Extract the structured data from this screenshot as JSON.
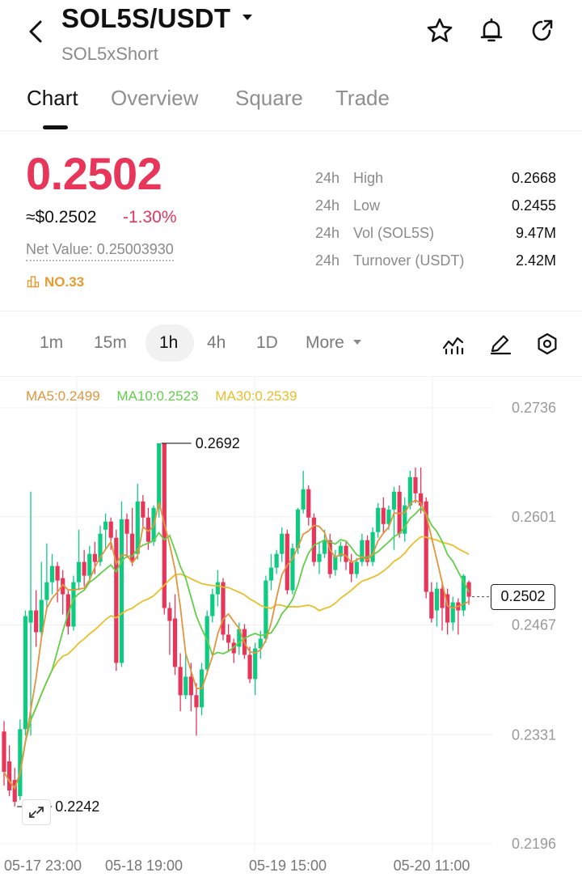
{
  "header": {
    "title": "SOL5S/USDT",
    "subtitle": "SOL5xShort"
  },
  "tabs": [
    {
      "label": "Chart",
      "active": true
    },
    {
      "label": "Overview",
      "active": false
    },
    {
      "label": "Square",
      "active": false
    },
    {
      "label": "Trade",
      "active": false
    }
  ],
  "ticker": {
    "last_price": "0.2502",
    "approx_usd": "≈$0.2502",
    "change_pct": "-1.30%",
    "net_value": "Net Value: 0.25003930",
    "rank": "NO.33",
    "down_color": "#e8355a",
    "up_color": "#0ecb81"
  },
  "stats": [
    {
      "period": "24h",
      "label": "High",
      "value": "0.2668"
    },
    {
      "period": "24h",
      "label": "Low",
      "value": "0.2455"
    },
    {
      "period": "24h",
      "label": "Vol (SOL5S)",
      "value": "9.47M"
    },
    {
      "period": "24h",
      "label": "Turnover (USDT)",
      "value": "2.42M"
    }
  ],
  "intervals": [
    {
      "label": "1m",
      "active": false
    },
    {
      "label": "15m",
      "active": false
    },
    {
      "label": "1h",
      "active": true
    },
    {
      "label": "4h",
      "active": false
    },
    {
      "label": "1D",
      "active": false
    },
    {
      "label": "More",
      "active": false
    }
  ],
  "toolbar_icons": [
    "indicator-icon",
    "draw-icon",
    "settings-icon"
  ],
  "ma": [
    {
      "label": "MA5:0.2499",
      "color": "#e2953f"
    },
    {
      "label": "MA10:0.2523",
      "color": "#62cf4a"
    },
    {
      "label": "MA30:0.2539",
      "color": "#e9bf2c"
    }
  ],
  "chart_data": {
    "type": "candlestick",
    "y_ticks": [
      "0.2736",
      "0.2601",
      "0.2467",
      "0.2331",
      "0.2196"
    ],
    "x_ticks": [
      "05-17 23:00",
      "05-18 19:00",
      "05-19 15:00",
      "05-20 11:00"
    ],
    "ylim": [
      0.2196,
      0.2736
    ],
    "high_label": "0.2692",
    "low_label": "0.2242",
    "current_price_label": "0.2502",
    "grid": true,
    "candles": [
      {
        "o": 0.2335,
        "c": 0.2285,
        "h": 0.2348,
        "l": 0.2268
      },
      {
        "o": 0.2298,
        "c": 0.2262,
        "h": 0.2318,
        "l": 0.2255
      },
      {
        "o": 0.2275,
        "c": 0.2248,
        "h": 0.229,
        "l": 0.2242
      },
      {
        "o": 0.2255,
        "c": 0.2338,
        "h": 0.235,
        "l": 0.225
      },
      {
        "o": 0.2338,
        "c": 0.2478,
        "h": 0.2485,
        "l": 0.233
      },
      {
        "o": 0.247,
        "c": 0.2485,
        "h": 0.2632,
        "l": 0.233
      },
      {
        "o": 0.2485,
        "c": 0.2458,
        "h": 0.251,
        "l": 0.244
      },
      {
        "o": 0.2458,
        "c": 0.2498,
        "h": 0.2545,
        "l": 0.245
      },
      {
        "o": 0.2498,
        "c": 0.252,
        "h": 0.2568,
        "l": 0.2485
      },
      {
        "o": 0.252,
        "c": 0.254,
        "h": 0.2555,
        "l": 0.2505
      },
      {
        "o": 0.254,
        "c": 0.2522,
        "h": 0.2545,
        "l": 0.2495
      },
      {
        "o": 0.2525,
        "c": 0.2505,
        "h": 0.2535,
        "l": 0.248
      },
      {
        "o": 0.2505,
        "c": 0.2465,
        "h": 0.251,
        "l": 0.2455
      },
      {
        "o": 0.2465,
        "c": 0.252,
        "h": 0.2528,
        "l": 0.246
      },
      {
        "o": 0.252,
        "c": 0.2545,
        "h": 0.2585,
        "l": 0.251
      },
      {
        "o": 0.2545,
        "c": 0.2528,
        "h": 0.256,
        "l": 0.2515
      },
      {
        "o": 0.2528,
        "c": 0.2555,
        "h": 0.2565,
        "l": 0.252
      },
      {
        "o": 0.2555,
        "c": 0.2545,
        "h": 0.257,
        "l": 0.253
      },
      {
        "o": 0.2545,
        "c": 0.258,
        "h": 0.259,
        "l": 0.254
      },
      {
        "o": 0.2585,
        "c": 0.2595,
        "h": 0.2605,
        "l": 0.256
      },
      {
        "o": 0.2595,
        "c": 0.2575,
        "h": 0.26,
        "l": 0.256
      },
      {
        "o": 0.2575,
        "c": 0.242,
        "h": 0.2585,
        "l": 0.241
      },
      {
        "o": 0.242,
        "c": 0.2598,
        "h": 0.262,
        "l": 0.2415
      },
      {
        "o": 0.2598,
        "c": 0.258,
        "h": 0.2605,
        "l": 0.255
      },
      {
        "o": 0.258,
        "c": 0.2545,
        "h": 0.2612,
        "l": 0.254
      },
      {
        "o": 0.2555,
        "c": 0.262,
        "h": 0.2642,
        "l": 0.2548
      },
      {
        "o": 0.262,
        "c": 0.26,
        "h": 0.2628,
        "l": 0.2585
      },
      {
        "o": 0.26,
        "c": 0.257,
        "h": 0.2612,
        "l": 0.256
      },
      {
        "o": 0.257,
        "c": 0.2612,
        "h": 0.2615,
        "l": 0.2565
      },
      {
        "o": 0.2612,
        "c": 0.2692,
        "h": 0.2692,
        "l": 0.26
      },
      {
        "o": 0.2692,
        "c": 0.2488,
        "h": 0.2692,
        "l": 0.248
      },
      {
        "o": 0.2488,
        "c": 0.2472,
        "h": 0.2495,
        "l": 0.243
      },
      {
        "o": 0.2475,
        "c": 0.2415,
        "h": 0.2505,
        "l": 0.2405
      },
      {
        "o": 0.2415,
        "c": 0.238,
        "h": 0.2432,
        "l": 0.236
      },
      {
        "o": 0.238,
        "c": 0.2403,
        "h": 0.243,
        "l": 0.2375
      },
      {
        "o": 0.2403,
        "c": 0.238,
        "h": 0.242,
        "l": 0.236
      },
      {
        "o": 0.238,
        "c": 0.2365,
        "h": 0.2395,
        "l": 0.233
      },
      {
        "o": 0.2365,
        "c": 0.2412,
        "h": 0.242,
        "l": 0.2355
      },
      {
        "o": 0.2412,
        "c": 0.2478,
        "h": 0.2485,
        "l": 0.2405
      },
      {
        "o": 0.2478,
        "c": 0.2505,
        "h": 0.2512,
        "l": 0.247
      },
      {
        "o": 0.2505,
        "c": 0.252,
        "h": 0.2535,
        "l": 0.249
      },
      {
        "o": 0.252,
        "c": 0.2455,
        "h": 0.2525,
        "l": 0.2448
      },
      {
        "o": 0.2455,
        "c": 0.2445,
        "h": 0.2468,
        "l": 0.2435
      },
      {
        "o": 0.2445,
        "c": 0.2432,
        "h": 0.245,
        "l": 0.242
      },
      {
        "o": 0.244,
        "c": 0.2462,
        "h": 0.247,
        "l": 0.243
      },
      {
        "o": 0.2462,
        "c": 0.243,
        "h": 0.2468,
        "l": 0.2425
      },
      {
        "o": 0.243,
        "c": 0.24,
        "h": 0.244,
        "l": 0.2395
      },
      {
        "o": 0.24,
        "c": 0.2438,
        "h": 0.2445,
        "l": 0.238
      },
      {
        "o": 0.2438,
        "c": 0.245,
        "h": 0.246,
        "l": 0.2425
      },
      {
        "o": 0.245,
        "c": 0.2522,
        "h": 0.2528,
        "l": 0.2445
      },
      {
        "o": 0.2522,
        "c": 0.2538,
        "h": 0.2555,
        "l": 0.251
      },
      {
        "o": 0.2538,
        "c": 0.2555,
        "h": 0.256,
        "l": 0.253
      },
      {
        "o": 0.2555,
        "c": 0.258,
        "h": 0.2588,
        "l": 0.2545
      },
      {
        "o": 0.258,
        "c": 0.251,
        "h": 0.2585,
        "l": 0.2505
      },
      {
        "o": 0.251,
        "c": 0.2562,
        "h": 0.2568,
        "l": 0.2505
      },
      {
        "o": 0.2562,
        "c": 0.261,
        "h": 0.2612,
        "l": 0.2555
      },
      {
        "o": 0.261,
        "c": 0.2635,
        "h": 0.2658,
        "l": 0.2605
      },
      {
        "o": 0.2635,
        "c": 0.26,
        "h": 0.264,
        "l": 0.259
      },
      {
        "o": 0.26,
        "c": 0.2545,
        "h": 0.2605,
        "l": 0.254
      },
      {
        "o": 0.2545,
        "c": 0.2555,
        "h": 0.257,
        "l": 0.253
      },
      {
        "o": 0.2555,
        "c": 0.2572,
        "h": 0.2585,
        "l": 0.255
      },
      {
        "o": 0.2572,
        "c": 0.253,
        "h": 0.258,
        "l": 0.2525
      },
      {
        "o": 0.2535,
        "c": 0.2552,
        "h": 0.256,
        "l": 0.2528
      },
      {
        "o": 0.2552,
        "c": 0.2565,
        "h": 0.257,
        "l": 0.2545
      },
      {
        "o": 0.2565,
        "c": 0.2545,
        "h": 0.257,
        "l": 0.2535
      },
      {
        "o": 0.2545,
        "c": 0.253,
        "h": 0.2555,
        "l": 0.252
      },
      {
        "o": 0.253,
        "c": 0.2545,
        "h": 0.255,
        "l": 0.2525
      },
      {
        "o": 0.2545,
        "c": 0.2572,
        "h": 0.258,
        "l": 0.254
      },
      {
        "o": 0.2572,
        "c": 0.2545,
        "h": 0.2578,
        "l": 0.254
      },
      {
        "o": 0.2545,
        "c": 0.2582,
        "h": 0.2588,
        "l": 0.254
      },
      {
        "o": 0.2582,
        "c": 0.2612,
        "h": 0.2618,
        "l": 0.2575
      },
      {
        "o": 0.2612,
        "c": 0.2592,
        "h": 0.2625,
        "l": 0.258
      },
      {
        "o": 0.2592,
        "c": 0.261,
        "h": 0.2615,
        "l": 0.2585
      },
      {
        "o": 0.261,
        "c": 0.2632,
        "h": 0.2638,
        "l": 0.256
      },
      {
        "o": 0.2632,
        "c": 0.258,
        "h": 0.264,
        "l": 0.2575
      },
      {
        "o": 0.258,
        "c": 0.2615,
        "h": 0.2625,
        "l": 0.257
      },
      {
        "o": 0.2615,
        "c": 0.265,
        "h": 0.2658,
        "l": 0.261
      },
      {
        "o": 0.265,
        "c": 0.263,
        "h": 0.2662,
        "l": 0.2618
      },
      {
        "o": 0.263,
        "c": 0.2615,
        "h": 0.2662,
        "l": 0.2605
      },
      {
        "o": 0.262,
        "c": 0.2508,
        "h": 0.2625,
        "l": 0.25
      },
      {
        "o": 0.2508,
        "c": 0.2475,
        "h": 0.252,
        "l": 0.247
      },
      {
        "o": 0.2485,
        "c": 0.2512,
        "h": 0.252,
        "l": 0.2465
      },
      {
        "o": 0.2512,
        "c": 0.2488,
        "h": 0.2518,
        "l": 0.246
      },
      {
        "o": 0.2505,
        "c": 0.247,
        "h": 0.2512,
        "l": 0.2455
      },
      {
        "o": 0.247,
        "c": 0.2495,
        "h": 0.2502,
        "l": 0.246
      },
      {
        "o": 0.2495,
        "c": 0.2485,
        "h": 0.25,
        "l": 0.2455
      },
      {
        "o": 0.2485,
        "c": 0.2528,
        "h": 0.253,
        "l": 0.2478
      },
      {
        "o": 0.252,
        "c": 0.2502,
        "h": 0.2522,
        "l": 0.2492
      }
    ]
  }
}
